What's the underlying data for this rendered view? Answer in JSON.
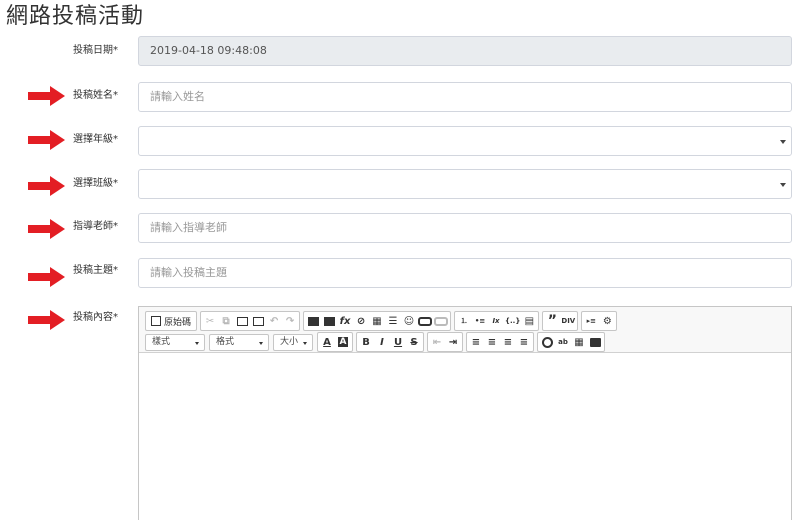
{
  "page": {
    "title": "網路投稿活動"
  },
  "form": {
    "date": {
      "label": "投稿日期*",
      "value": "2019-04-18 09:48:08"
    },
    "name": {
      "label": "投稿姓名*",
      "placeholder": "請輸入姓名"
    },
    "grade": {
      "label": "選擇年級*",
      "value": ""
    },
    "class": {
      "label": "選擇班級*",
      "value": ""
    },
    "teacher": {
      "label": "指導老師*",
      "placeholder": "請輸入指導老師"
    },
    "subject": {
      "label": "投稿主題*",
      "placeholder": "請輸入投稿主題"
    },
    "content": {
      "label": "投稿內容*"
    }
  },
  "editor": {
    "source_label": "原始碼",
    "combos": {
      "styles": "樣式",
      "format": "格式",
      "size": "大小"
    },
    "icons": {
      "cut": "✂",
      "copy": "⧉",
      "paste": "📋",
      "paste_word": "📋",
      "undo": "↶",
      "redo": "↷",
      "image": "▣",
      "flash": "▦",
      "formula": "fx",
      "special": "⊘",
      "table": "▦",
      "hr": "☰",
      "smiley": "☺",
      "link": "🔗",
      "unlink": "⛓",
      "numbered_list": "⒈",
      "bulleted_list": "•≡",
      "remove_format": "Ix",
      "block": "{..}",
      "show_blocks": "▤",
      "blockquote": "”",
      "create_div": "DIV",
      "indent_text": "▸≡",
      "settings": "⚙",
      "text_color": "A",
      "bg_color": "A",
      "bold": "B",
      "italic": "I",
      "underline": "U",
      "strike": "S",
      "outdent": "⇤",
      "indent": "⇥",
      "align_left": "≡",
      "align_center": "≡",
      "align_right": "≡",
      "justify": "≡",
      "find": "🔍",
      "replace": "ab",
      "select_all": "▦",
      "maximize": "▭"
    }
  },
  "colors": {
    "arrow": "#e31e24",
    "readonly_bg": "#e9ecef",
    "border": "#d2d6de"
  }
}
